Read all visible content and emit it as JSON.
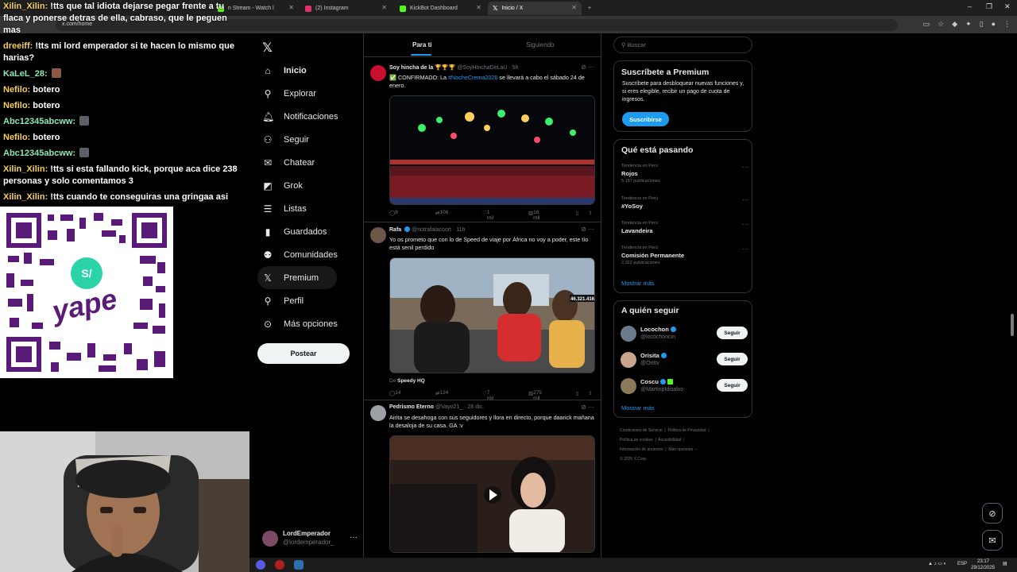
{
  "browser": {
    "tabs": [
      {
        "label": "n Stream - Watch l",
        "color": "#53fc18"
      },
      {
        "label": "(2) Instagram",
        "color": "#e1306c"
      },
      {
        "label": "KickBot Dashboard",
        "color": "#53fc18"
      },
      {
        "label": "Inicio / X",
        "color": "#ffffff"
      }
    ],
    "new_tab": "+",
    "url": "x.com/home",
    "window_controls": [
      "–",
      "❐",
      "✕"
    ]
  },
  "chat": [
    {
      "user": "Xilin_Xilin:",
      "text": "!tts que tal idiota dejarse pegar frente a tu flaca y ponerse detras de ella, cabraso, que le peguen mas"
    },
    {
      "user": "dreeiff:",
      "text": "!tts mi lord emperador si te hacen lo mismo que harias?"
    },
    {
      "user": "KaLeL_28:",
      "text": ""
    },
    {
      "user": "Nefilo:",
      "text": "botero"
    },
    {
      "user": "Nefilo:",
      "text": "botero"
    },
    {
      "user": "Abc12345abcww:",
      "text": ""
    },
    {
      "user": "Nefilo:",
      "text": "botero"
    },
    {
      "user": "Abc12345abcww:",
      "text": ""
    },
    {
      "user": "Xilin_Xilin:",
      "text": "!tts si esta fallando kick, porque aca dice 238 personas y solo comentamos 3"
    },
    {
      "user": "Xilin_Xilin:",
      "text": "!tts cuando te conseguiras una gringaa asi"
    }
  ],
  "qr": {
    "brand": "yape",
    "badge": "S/"
  },
  "nav": {
    "items": [
      {
        "label": "Inicio",
        "icon": "home-icon"
      },
      {
        "label": "Explorar",
        "icon": "search-icon"
      },
      {
        "label": "Notificaciones",
        "icon": "bell-icon"
      },
      {
        "label": "Seguir",
        "icon": "person-add-icon"
      },
      {
        "label": "Chatear",
        "icon": "mail-icon"
      },
      {
        "label": "Grok",
        "icon": "grok-icon"
      },
      {
        "label": "Listas",
        "icon": "list-icon"
      },
      {
        "label": "Guardados",
        "icon": "bookmark-icon"
      },
      {
        "label": "Comunidades",
        "icon": "communities-icon"
      },
      {
        "label": "Premium",
        "icon": "x-icon"
      },
      {
        "label": "Perfil",
        "icon": "person-icon"
      },
      {
        "label": "Más opciones",
        "icon": "more-icon"
      }
    ],
    "post_label": "Postear",
    "account_name": "LordEmperador",
    "account_handle": "@lordemperador_",
    "account_more": "···"
  },
  "timeline": {
    "tabs": [
      "Para ti",
      "Siguiendo"
    ],
    "tweets": [
      {
        "name": "Soy hincha de la",
        "handle": "@SoyHInchaDeLaU · 5h",
        "text_prefix": "✅ CONFIRMADO: La ",
        "hashtag": "#NocheCrema2026",
        "text_suffix": " se llevará a cabo el sábado 24 de enero.",
        "replies": "8",
        "reposts": "106",
        "likes": "1 mil",
        "views": "16 mil"
      },
      {
        "name": "Rafa",
        "handle": "@notrafalacoort · 11h",
        "text": "Yo os prometo que con lo de Speed de viaje por África no voy a poder, este tío está senil perdido",
        "media_badge": "46.321.416",
        "from_prefix": "De",
        "from_source": "Speedy HQ",
        "replies": "14",
        "reposts": "124",
        "likes": "7 mil",
        "views": "275 mil"
      },
      {
        "name": "Pedrismo Eterno",
        "handle": "@Vayo21_ · 28 dic.",
        "text": "Airita se desahoga con sus seguidores y llora en directo, porque daarick mañana la desaloja de su casa. GA :v"
      }
    ]
  },
  "sidebar": {
    "search_placeholder": "Buscar",
    "premium": {
      "title": "Suscríbete a Premium",
      "text": "Suscríbete para desbloquear nuevas funciones y, si eres elegible, recibir un pago de cuota de ingresos.",
      "button": "Suscribirse"
    },
    "trending": {
      "title": "Qué está pasando",
      "items": [
        {
          "context": "Tendencia en Perú",
          "topic": "Rojos",
          "count": "5.187 publicaciones"
        },
        {
          "context": "Tendencia en Perú",
          "topic": "#YoSoy",
          "count": ""
        },
        {
          "context": "Tendencia en Perú",
          "topic": "Lavandeira",
          "count": ""
        },
        {
          "context": "Tendencia en Perú",
          "topic": "Comisión Permanente",
          "count": "2.022 publicaciones"
        }
      ],
      "show_more": "Mostrar más"
    },
    "who_to_follow": {
      "title": "A quién seguir",
      "items": [
        {
          "name": "Locochon",
          "handle": "@locochoncin",
          "avatar_color": "#6a7a8a"
        },
        {
          "name": "Orisita",
          "handle": "@Orittv",
          "avatar_color": "#c9a58e"
        },
        {
          "name": "Coscu",
          "handle": "@MartinpIdisalvo",
          "avatar_color": "#8a7a5a"
        }
      ],
      "follow_label": "Seguir",
      "show_more": "Mostrar más"
    },
    "footer": [
      "Condiciones de Servicio",
      "Política de Privacidad",
      "Política de cookies",
      "Accesibilidad",
      "Información de anuncios",
      "Más opciones ···",
      "© 2025 X Corp."
    ]
  },
  "taskbar": {
    "lang": "ESP",
    "time": "23:17",
    "date": "29/12/2025"
  },
  "colors": {
    "accent": "#1d9bf0",
    "background": "#000000",
    "border": "#2f3336"
  }
}
